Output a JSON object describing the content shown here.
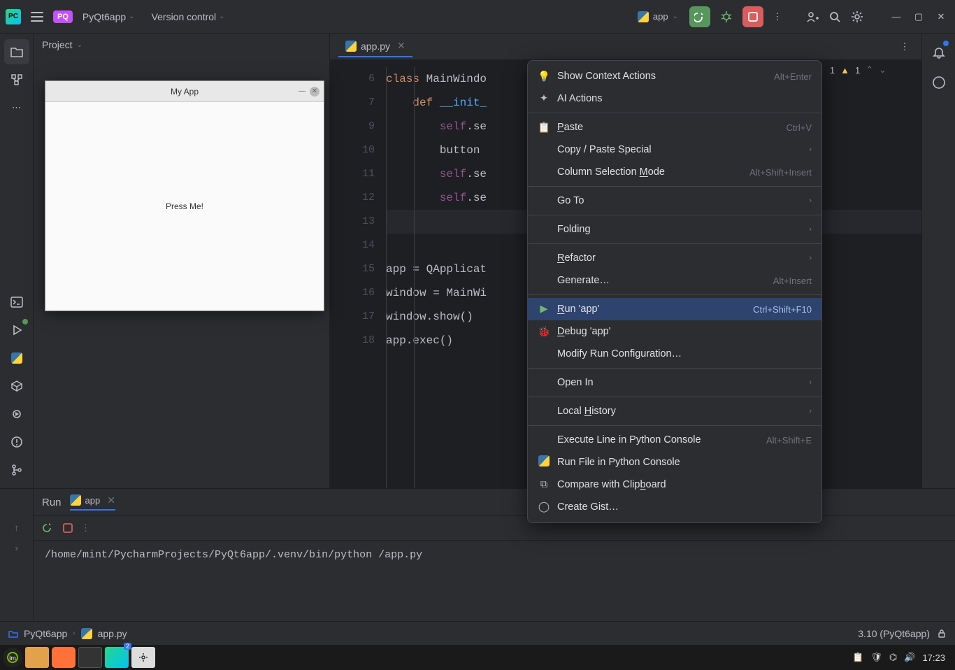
{
  "titlebar": {
    "hamburger": "menu",
    "project_badge": "PQ",
    "project_name": "PyQt6app",
    "version_control": "Version control",
    "run_config_name": "app"
  },
  "project_panel": {
    "title": "Project"
  },
  "editor": {
    "tab_name": "app.py",
    "warnings_count_1": "1",
    "warnings_count_2": "1",
    "gutter_start": 6,
    "lines": [
      {
        "n": 6,
        "html": "<span class='kw'>class</span> MainWindo"
      },
      {
        "n": 7,
        "html": "    <span class='kw'>def</span> <span class='fn'>__init_</span>"
      },
      {
        "n": 9,
        "html": "        <span class='self'>self</span>.se"
      },
      {
        "n": 10,
        "html": "        button "
      },
      {
        "n": 11,
        "html": "        <span class='self'>self</span>.se"
      },
      {
        "n": 12,
        "html": "        <span class='self'>self</span>.se"
      },
      {
        "n": 13,
        "html": "",
        "current": true
      },
      {
        "n": 14,
        "html": ""
      },
      {
        "n": 15,
        "html": "app = QApplicat"
      },
      {
        "n": 16,
        "html": "window = MainWi"
      },
      {
        "n": 17,
        "html": "window.show()"
      },
      {
        "n": 18,
        "html": "app.exec()"
      }
    ]
  },
  "run_panel": {
    "tab_run": "Run",
    "tab_name": "app",
    "output": "/home/mint/PycharmProjects/PyQt6app/.venv/bin/python                 /app.py"
  },
  "breadcrumb": {
    "root": "PyQt6app",
    "file": "app.py",
    "interpreter": "3.10 (PyQt6app)"
  },
  "popup": {
    "title": "My App",
    "button": "Press Me!"
  },
  "context_menu": {
    "show_context": "Show Context Actions",
    "show_context_sc": "Alt+Enter",
    "ai_actions": "AI Actions",
    "paste": "Paste",
    "paste_sc": "Ctrl+V",
    "copy_paste_special": "Copy / Paste Special",
    "column_sel": "Column Selection Mode",
    "column_sel_sc": "Alt+Shift+Insert",
    "go_to": "Go To",
    "folding": "Folding",
    "refactor": "Refactor",
    "generate": "Generate…",
    "generate_sc": "Alt+Insert",
    "run_app": "Run 'app'",
    "run_app_sc": "Ctrl+Shift+F10",
    "debug_app": "Debug 'app'",
    "modify_run": "Modify Run Configuration…",
    "open_in": "Open In",
    "local_history": "Local History",
    "exec_line": "Execute Line in Python Console",
    "exec_line_sc": "Alt+Shift+E",
    "run_file": "Run File in Python Console",
    "compare_clip": "Compare with Clipboard",
    "create_gist": "Create Gist…"
  },
  "taskbar": {
    "time": "17:23"
  }
}
